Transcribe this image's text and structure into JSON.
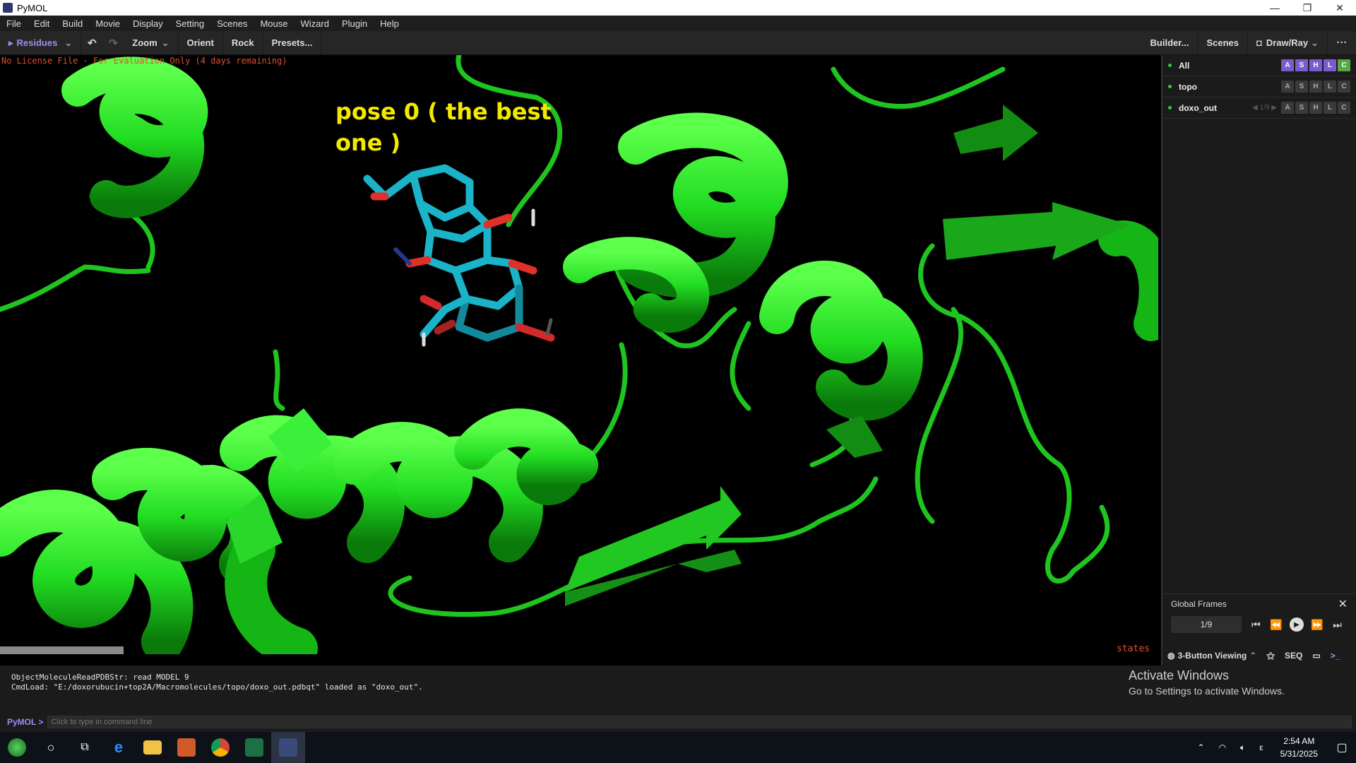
{
  "window": {
    "title": "PyMOL",
    "minimize": "—",
    "restore": "❐",
    "close": "✕"
  },
  "menu": [
    "File",
    "Edit",
    "Build",
    "Movie",
    "Display",
    "Setting",
    "Scenes",
    "Mouse",
    "Wizard",
    "Plugin",
    "Help"
  ],
  "toolbar": {
    "residues": "Residues",
    "zoom": "Zoom",
    "orient": "Orient",
    "rock": "Rock",
    "presets": "Presets...",
    "builder": "Builder...",
    "scenes": "Scenes",
    "draw_ray": "Draw/Ray",
    "more": "···"
  },
  "viewport": {
    "license": "No License File - For Evaluation Only (4 days remaining)",
    "annotation": "pose 0 ( the best one )",
    "states_label": "states",
    "protein_color": "#22dd22",
    "ligand_color": "#1ab3c8"
  },
  "objects": [
    {
      "name": "All",
      "state": "",
      "controls": [
        "A",
        "S",
        "H",
        "L",
        "C"
      ]
    },
    {
      "name": "topo",
      "state": "",
      "controls": [
        "A",
        "S",
        "H",
        "L",
        "C"
      ]
    },
    {
      "name": "doxo_out",
      "state": "◀ 1/9 ▶",
      "controls": [
        "A",
        "S",
        "H",
        "L",
        "C"
      ]
    }
  ],
  "frames": {
    "title": "Global Frames",
    "close": "✕",
    "counter": "1/9"
  },
  "mousebar": {
    "mode": "3-Button Viewing",
    "seq": "SEQ",
    "prompt": ">_"
  },
  "console": {
    "lines": [
      "ObjectMoleculeReadPDBStr: read MODEL 9",
      "CmdLoad: \"E:/doxorubucin+top2A/Macromolecules/topo/doxo_out.pdbqt\" loaded as \"doxo_out\"."
    ],
    "prompt": "PyMOL >",
    "placeholder": "Click to type in command line"
  },
  "watermark": {
    "line1": "Activate Windows",
    "line2": "Go to Settings to activate Windows."
  },
  "taskbar": {
    "time": "2:54 AM",
    "date": "5/31/2025",
    "lang": "ε"
  }
}
